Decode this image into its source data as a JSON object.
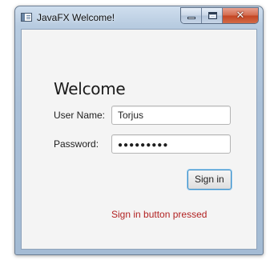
{
  "window": {
    "title": "JavaFX Welcome!",
    "caption_buttons": {
      "minimize": "minimize",
      "maximize": "maximize",
      "close": "✕"
    }
  },
  "form": {
    "heading": "Welcome",
    "username": {
      "label": "User Name:",
      "value": "Torjus"
    },
    "password": {
      "label": "Password:",
      "masked_value": "●●●●●●●●●"
    },
    "signin_button": "Sign in",
    "status_message": "Sign in button pressed"
  },
  "colors": {
    "status_text": "#b22222",
    "button_focus": "#3d8fc7",
    "close_button": "#c44523"
  },
  "icons": {
    "app": "java-window-icon",
    "minimize": "minimize-icon",
    "maximize": "maximize-icon",
    "close": "close-icon"
  }
}
